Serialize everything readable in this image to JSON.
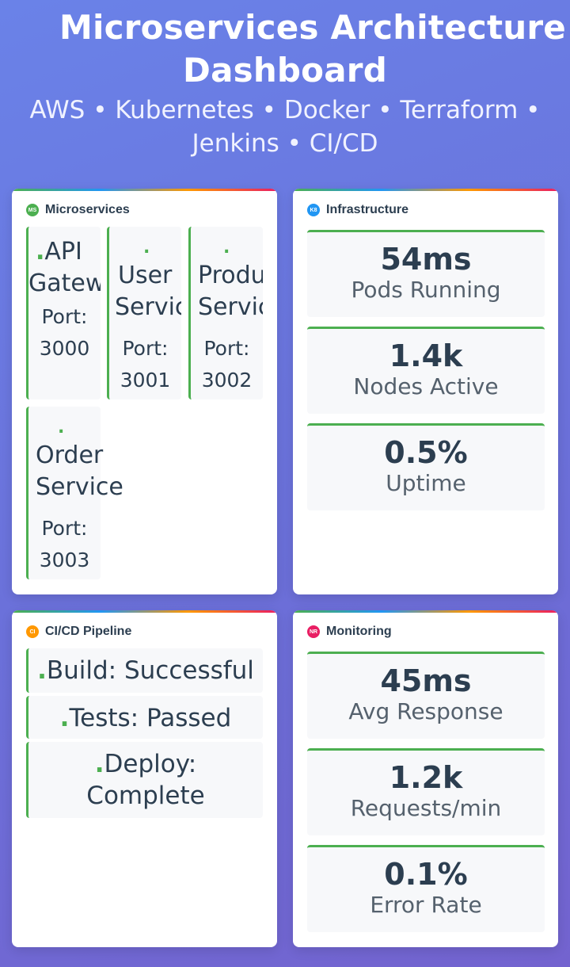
{
  "header": {
    "title_line1": "Microservices Architecture",
    "title_line2": "Dashboard",
    "subtitle_line1": "AWS • Kubernetes • Docker • Terraform •",
    "subtitle_line2": "Jenkins • CI/CD"
  },
  "microservices": {
    "title": "Microservices",
    "badge": "MS",
    "badge_color": "#4caf50",
    "services": [
      {
        "dot": ".",
        "name1": "API",
        "name2": "Gateway",
        "port1": "Port:",
        "port2": "3000"
      },
      {
        "dot": ".",
        "name1": "User",
        "name2": "Service",
        "port1": "Port:",
        "port2": "3001"
      },
      {
        "dot": ".",
        "name1": "Product",
        "name2": "Service",
        "port1": "Port:",
        "port2": "3002"
      },
      {
        "dot": ".",
        "name1": "Order",
        "name2": "Service",
        "port1": "Port:",
        "port2": "3003"
      }
    ]
  },
  "infrastructure": {
    "title": "Infrastructure",
    "badge": "K8",
    "badge_color": "#2196f3",
    "metrics": [
      {
        "value": "54ms",
        "label": "Pods Running"
      },
      {
        "value": "1.4k",
        "label": "Nodes Active"
      },
      {
        "value": "0.5%",
        "label": "Uptime"
      }
    ]
  },
  "pipeline": {
    "title": "CI/CD Pipeline",
    "badge": "CI",
    "badge_color": "#ff9800",
    "stages": [
      {
        "dot": ".",
        "text": "Build: Successful"
      },
      {
        "dot": ".",
        "text": "Tests: Passed"
      },
      {
        "dot": ".",
        "text1": "Deploy:",
        "text2": "Complete"
      }
    ]
  },
  "monitoring": {
    "title": "Monitoring",
    "badge": "NR",
    "badge_color": "#e91e63",
    "metrics": [
      {
        "value": "45ms",
        "label": "Avg Response"
      },
      {
        "value": "1.2k",
        "label": "Requests/min"
      },
      {
        "value": "0.1%",
        "label": "Error Rate"
      }
    ]
  }
}
